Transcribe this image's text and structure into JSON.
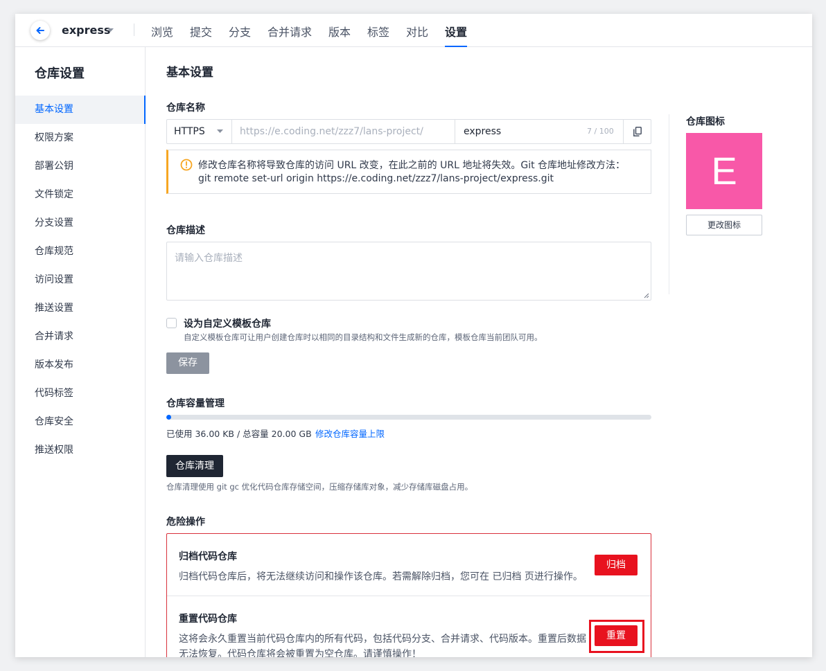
{
  "topnav": {
    "repo_name": "express",
    "tabs": [
      "浏览",
      "提交",
      "分支",
      "合并请求",
      "版本",
      "标签",
      "对比",
      "设置"
    ],
    "active_tab": "设置"
  },
  "sidebar": {
    "title": "仓库设置",
    "items": [
      "基本设置",
      "权限方案",
      "部署公钥",
      "文件锁定",
      "分支设置",
      "仓库规范",
      "访问设置",
      "推送设置",
      "合并请求",
      "版本发布",
      "代码标签",
      "仓库安全",
      "推送权限"
    ],
    "active": "基本设置"
  },
  "main": {
    "title": "基本设置",
    "repo_name_label": "仓库名称",
    "protocol": "HTTPS",
    "url_prefix": "https://e.coding.net/zzz7/lans-project/",
    "repo_name_value": "express",
    "name_counter": "7 / 100",
    "warning_line1": "修改仓库名称将导致仓库的访问 URL 改变，在此之前的 URL 地址将失效。Git 仓库地址修改方法：",
    "warning_line2": "git remote set-url origin https://e.coding.net/zzz7/lans-project/express.git",
    "desc_label": "仓库描述",
    "desc_placeholder": "请输入仓库描述",
    "template_label": "设为自定义模板仓库",
    "template_hint": "自定义模板仓库可让用户创建仓库时以相同的目录结构和文件生成新的仓库，模板仓库当前团队可用。",
    "save_label": "保存",
    "capacity_label": "仓库容量管理",
    "capacity_used_fraction": 0.0018,
    "capacity_text": "已使用 36.00 KB / 总容量 20.00 GB",
    "capacity_link": "修改仓库容量上限",
    "gc_button": "仓库清理",
    "gc_hint": "仓库清理使用 git gc 优化代码仓库存储空间，压缩存储库对象，减少存储库磁盘占用。",
    "danger_label": "危险操作",
    "archive_title": "归档代码仓库",
    "archive_text": "归档代码仓库后，将无法继续访问和操作该仓库。若需解除归档，您可在 已归档 页进行操作。",
    "archive_button": "归档",
    "reset_title": "重置代码仓库",
    "reset_text1": "这将会永久重置当前代码仓库内的所有代码，包括代码分支、合并请求、代码版本。重置后数据",
    "reset_text2": "无法恢复。代码仓库将会被重置为空仓库。请谨慎操作！",
    "reset_button": "重置"
  },
  "icon_panel": {
    "label": "仓库图标",
    "letter": "E",
    "color": "#f858a8",
    "change_button": "更改图标"
  }
}
